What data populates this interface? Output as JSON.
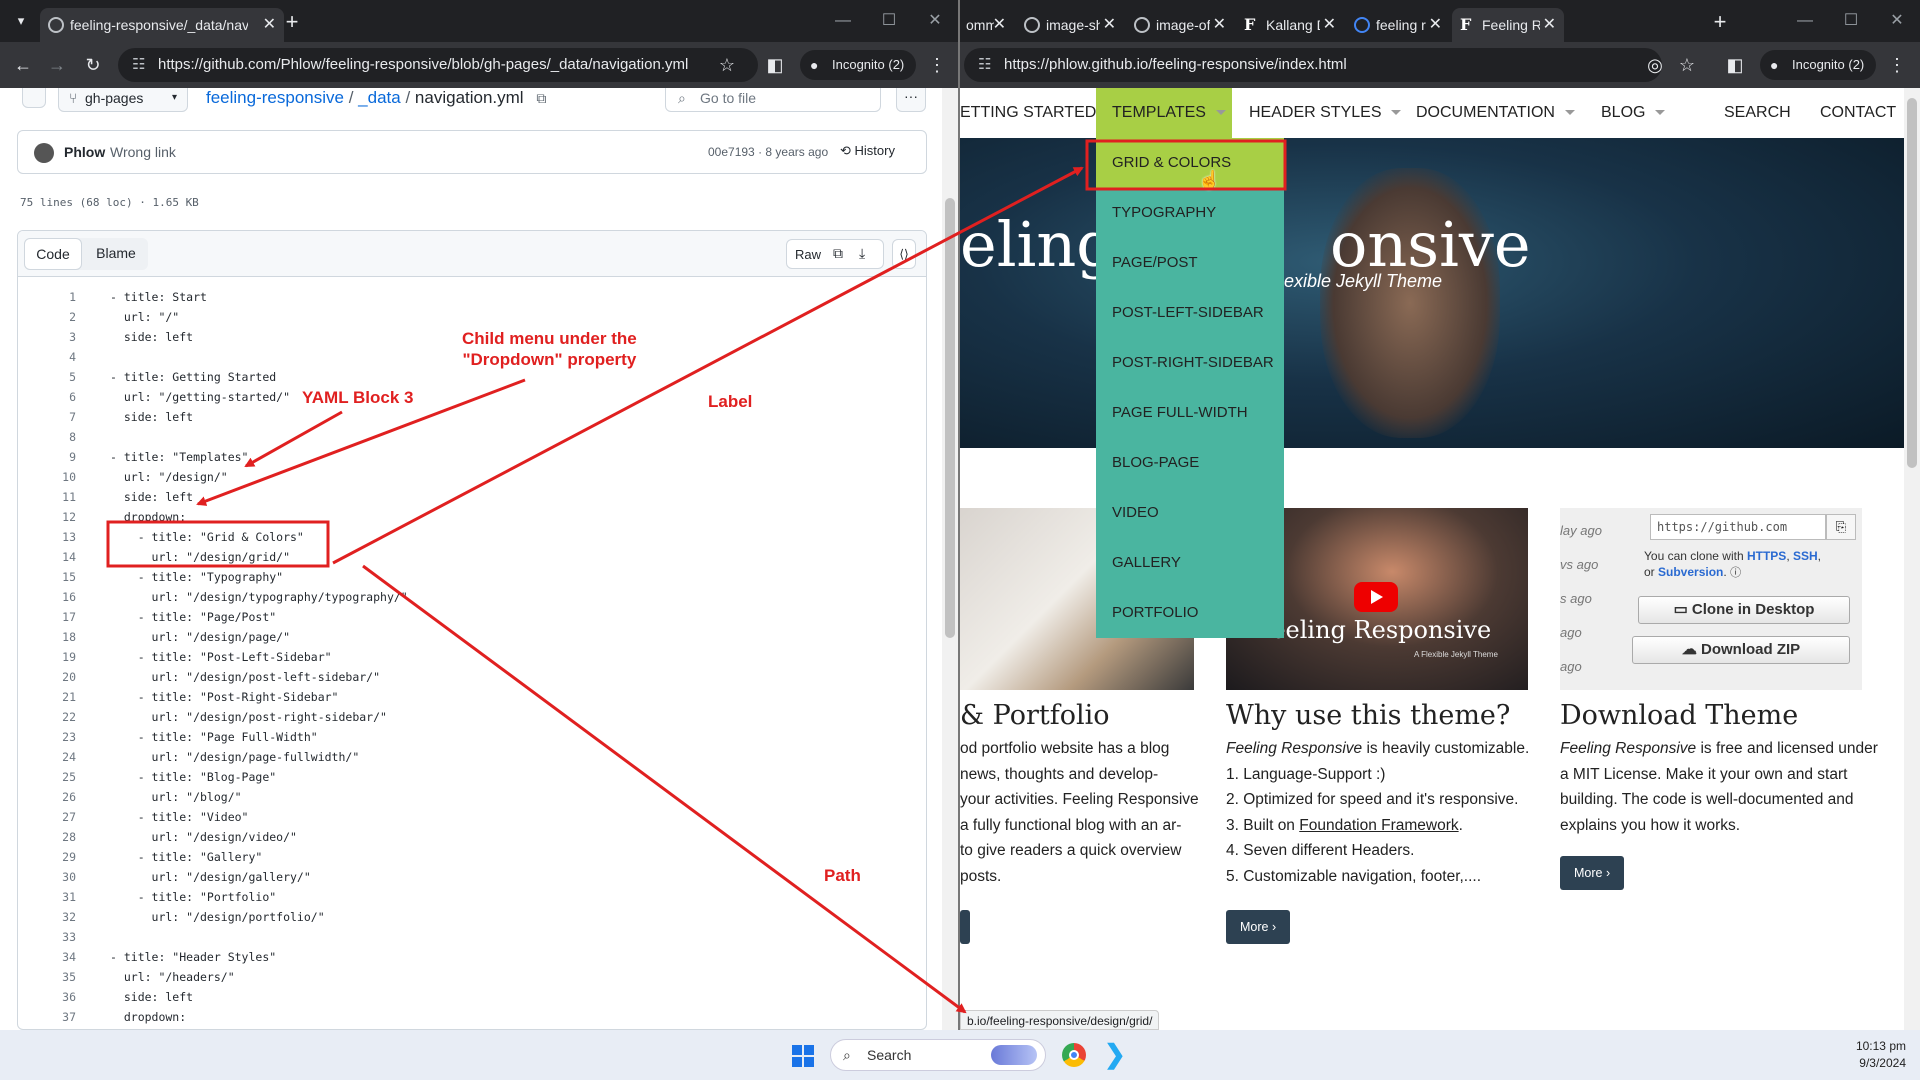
{
  "colors": {
    "accent_green": "#a8cf45",
    "dropdown_teal": "#4ab5a0",
    "annotation_red": "#e02020",
    "gh_link": "#0969da",
    "button_dark": "#2d4152"
  },
  "left_browser": {
    "tab_title": "feeling-responsive/_data/navig",
    "url": "https://github.com/Phlow/feeling-responsive/blob/gh-pages/_data/navigation.yml",
    "incognito": "Incognito (2)"
  },
  "github": {
    "branch": "gh-pages",
    "breadcrumb": {
      "repo": "feeling-responsive",
      "sep1": "/",
      "folder": "_data",
      "sep2": "/",
      "file": "navigation.yml"
    },
    "search_placeholder": "Go to file",
    "commit": {
      "author": "Phlow",
      "message": "Wrong link",
      "hash": "00e7193",
      "dot": "·",
      "age": "8 years ago",
      "history": "History"
    },
    "file_info": "75 lines (68 loc) · 1.65 KB",
    "tabs": {
      "code": "Code",
      "blame": "Blame"
    },
    "raw": "Raw",
    "lines": [
      {
        "n": "1",
        "t": "- title: Start"
      },
      {
        "n": "2",
        "t": "  url: \"/\""
      },
      {
        "n": "3",
        "t": "  side: left"
      },
      {
        "n": "4",
        "t": ""
      },
      {
        "n": "5",
        "t": "- title: Getting Started"
      },
      {
        "n": "6",
        "t": "  url: \"/getting-started/\""
      },
      {
        "n": "7",
        "t": "  side: left"
      },
      {
        "n": "8",
        "t": ""
      },
      {
        "n": "9",
        "t": "- title: \"Templates\""
      },
      {
        "n": "10",
        "t": "  url: \"/design/\""
      },
      {
        "n": "11",
        "t": "  side: left"
      },
      {
        "n": "12",
        "t": "  dropdown:"
      },
      {
        "n": "13",
        "t": "    - title: \"Grid & Colors\""
      },
      {
        "n": "14",
        "t": "      url: \"/design/grid/\""
      },
      {
        "n": "15",
        "t": "    - title: \"Typography\""
      },
      {
        "n": "16",
        "t": "      url: \"/design/typography/typography/\""
      },
      {
        "n": "17",
        "t": "    - title: \"Page/Post\""
      },
      {
        "n": "18",
        "t": "      url: \"/design/page/\""
      },
      {
        "n": "19",
        "t": "    - title: \"Post-Left-Sidebar\""
      },
      {
        "n": "20",
        "t": "      url: \"/design/post-left-sidebar/\""
      },
      {
        "n": "21",
        "t": "    - title: \"Post-Right-Sidebar\""
      },
      {
        "n": "22",
        "t": "      url: \"/design/post-right-sidebar/\""
      },
      {
        "n": "23",
        "t": "    - title: \"Page Full-Width\""
      },
      {
        "n": "24",
        "t": "      url: \"/design/page-fullwidth/\""
      },
      {
        "n": "25",
        "t": "    - title: \"Blog-Page\""
      },
      {
        "n": "26",
        "t": "      url: \"/blog/\""
      },
      {
        "n": "27",
        "t": "    - title: \"Video\""
      },
      {
        "n": "28",
        "t": "      url: \"/design/video/\""
      },
      {
        "n": "29",
        "t": "    - title: \"Gallery\""
      },
      {
        "n": "30",
        "t": "      url: \"/design/gallery/\""
      },
      {
        "n": "31",
        "t": "    - title: \"Portfolio\""
      },
      {
        "n": "32",
        "t": "      url: \"/design/portfolio/\""
      },
      {
        "n": "33",
        "t": ""
      },
      {
        "n": "34",
        "t": "- title: \"Header Styles\""
      },
      {
        "n": "35",
        "t": "  url: \"/headers/\""
      },
      {
        "n": "36",
        "t": "  side: left"
      },
      {
        "n": "37",
        "t": "  dropdown:"
      }
    ]
  },
  "right_browser": {
    "tabs": [
      {
        "label": "omm",
        "favicon": "none"
      },
      {
        "label": "image-show",
        "favicon": "globe"
      },
      {
        "label": "image-of-s",
        "favicon": "globe"
      },
      {
        "label": "Kallang Dog",
        "favicon": "F"
      },
      {
        "label": "feeling resp",
        "favicon": "google"
      },
      {
        "label": "Feeling Resp",
        "favicon": "F"
      }
    ],
    "url": "https://phlow.github.io/feeling-responsive/index.html",
    "incognito": "Incognito (2)"
  },
  "site": {
    "nav": [
      "ETTING STARTED",
      "TEMPLATES",
      "HEADER STYLES",
      "DOCUMENTATION",
      "BLOG",
      "SEARCH",
      "CONTACT"
    ],
    "dropdown": [
      "GRID & COLORS",
      "TYPOGRAPHY",
      "PAGE/POST",
      "POST-LEFT-SIDEBAR",
      "POST-RIGHT-SIDEBAR",
      "PAGE FULL-WIDTH",
      "BLOG-PAGE",
      "VIDEO",
      "GALLERY",
      "PORTFOLIO"
    ],
    "hero_title": "eling",
    "hero_title_right": "onsive",
    "hero_subtitle": "exible Jekyll Theme",
    "video_title": "Feeling Responsive",
    "video_subtitle": "A Flexible Jekyll Theme",
    "col1": {
      "heading": "& Portfolio",
      "lines": [
        "od portfolio website has a blog",
        "news, thoughts and develop-",
        "your activities. Feeling Responsive",
        "a fully functional blog with an ar-",
        "to give readers a quick overview",
        "posts."
      ]
    },
    "col2": {
      "heading": "Why use this theme?",
      "intro_em": "Feeling Responsive",
      "intro_rest": " is heavily customizable.",
      "items": [
        "1. Language-Support :)",
        "2. Optimized for speed and it's responsive.",
        "3. Built on ",
        "4. Seven different Headers.",
        "5. Customizable navigation, footer,...."
      ],
      "link": "Foundation Framework",
      "link_after": ".",
      "more": "More ›"
    },
    "col3": {
      "heading": "Download Theme",
      "intro_em": "Feeling Responsive",
      "lines": [
        " is free and licensed under",
        "a MIT License. Make it your own and start",
        "building. The code is well-documented and",
        "explains you how it works."
      ],
      "more": "More ›"
    },
    "clone_panel": {
      "url_placeholder": "https://github.com",
      "text1": "You can clone with ",
      "https": "HTTPS",
      "comma": ", ",
      "ssh": "SSH",
      "text2": ",",
      "or": "or ",
      "subversion": "Subversion",
      "dot": ".",
      "clone_btn": "Clone in Desktop",
      "zip_btn": "Download ZIP",
      "ago": [
        "lay ago",
        "vs ago",
        "s ago",
        "ago",
        "ago"
      ]
    },
    "status_url": "b.io/feeling-responsive/design/grid/"
  },
  "annotations": {
    "child_menu": "Child menu under the\n\"Dropdown\" property",
    "yaml_block": "YAML Block 3",
    "label": "Label",
    "path": "Path"
  },
  "taskbar": {
    "search": "Search",
    "time": "10:13 pm",
    "date": "9/3/2024"
  }
}
